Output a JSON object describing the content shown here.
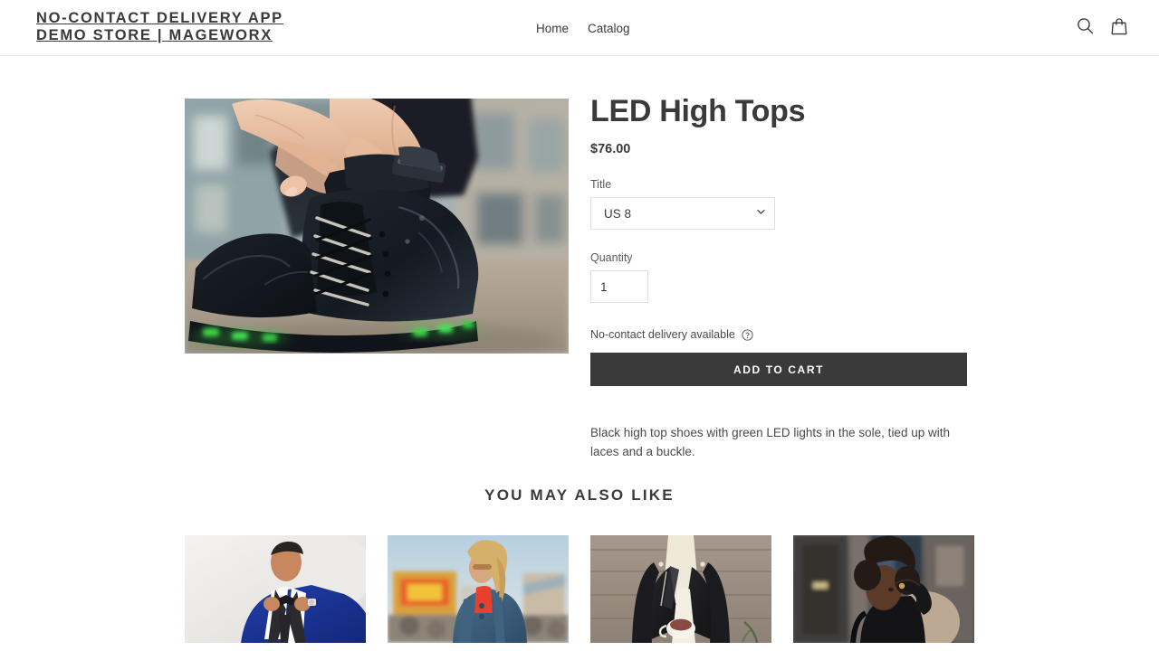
{
  "header": {
    "brand_line1": "No-contact delivery app",
    "brand_line2": "Demo store | MageWorx",
    "brand_text": "No-contact delivery app\nDemo store | MageWorx",
    "nav": [
      {
        "label": "Home"
      },
      {
        "label": "Catalog"
      }
    ],
    "icons": {
      "search": "search-icon",
      "cart": "shopping-bag-icon"
    }
  },
  "product": {
    "title": "LED High Tops",
    "price": "$76.00",
    "image_alt": "Hands lacing black high top sneakers with green LED lights in the sole",
    "variant": {
      "label": "Title",
      "selected": "US 8",
      "options": [
        "US 8"
      ]
    },
    "quantity": {
      "label": "Quantity",
      "value": "1"
    },
    "delivery": {
      "text": "No-contact delivery available",
      "help_icon": "help-circle-icon"
    },
    "add_to_cart_label": "Add to cart",
    "description": "Black high top shoes with green LED lights in the sole, tied up with laces and a buckle."
  },
  "related": {
    "heading": "You may also like",
    "items": [
      {
        "alt": "Man in blue patterned tuxedo with bow tie"
      },
      {
        "alt": "Woman in denim jacket and red top at a fairground"
      },
      {
        "alt": "Person in black quilted leather jacket holding a mug"
      },
      {
        "alt": "Woman with curly hair in black top on a city street"
      }
    ]
  },
  "colors": {
    "text": "#3a3a3a",
    "muted": "#5b5b5b",
    "border": "#e0e0e0",
    "header_border": "#eaeaea",
    "button_bg": "#3a3a3a",
    "button_text": "#ffffff",
    "led_green": "#3fd84a"
  }
}
